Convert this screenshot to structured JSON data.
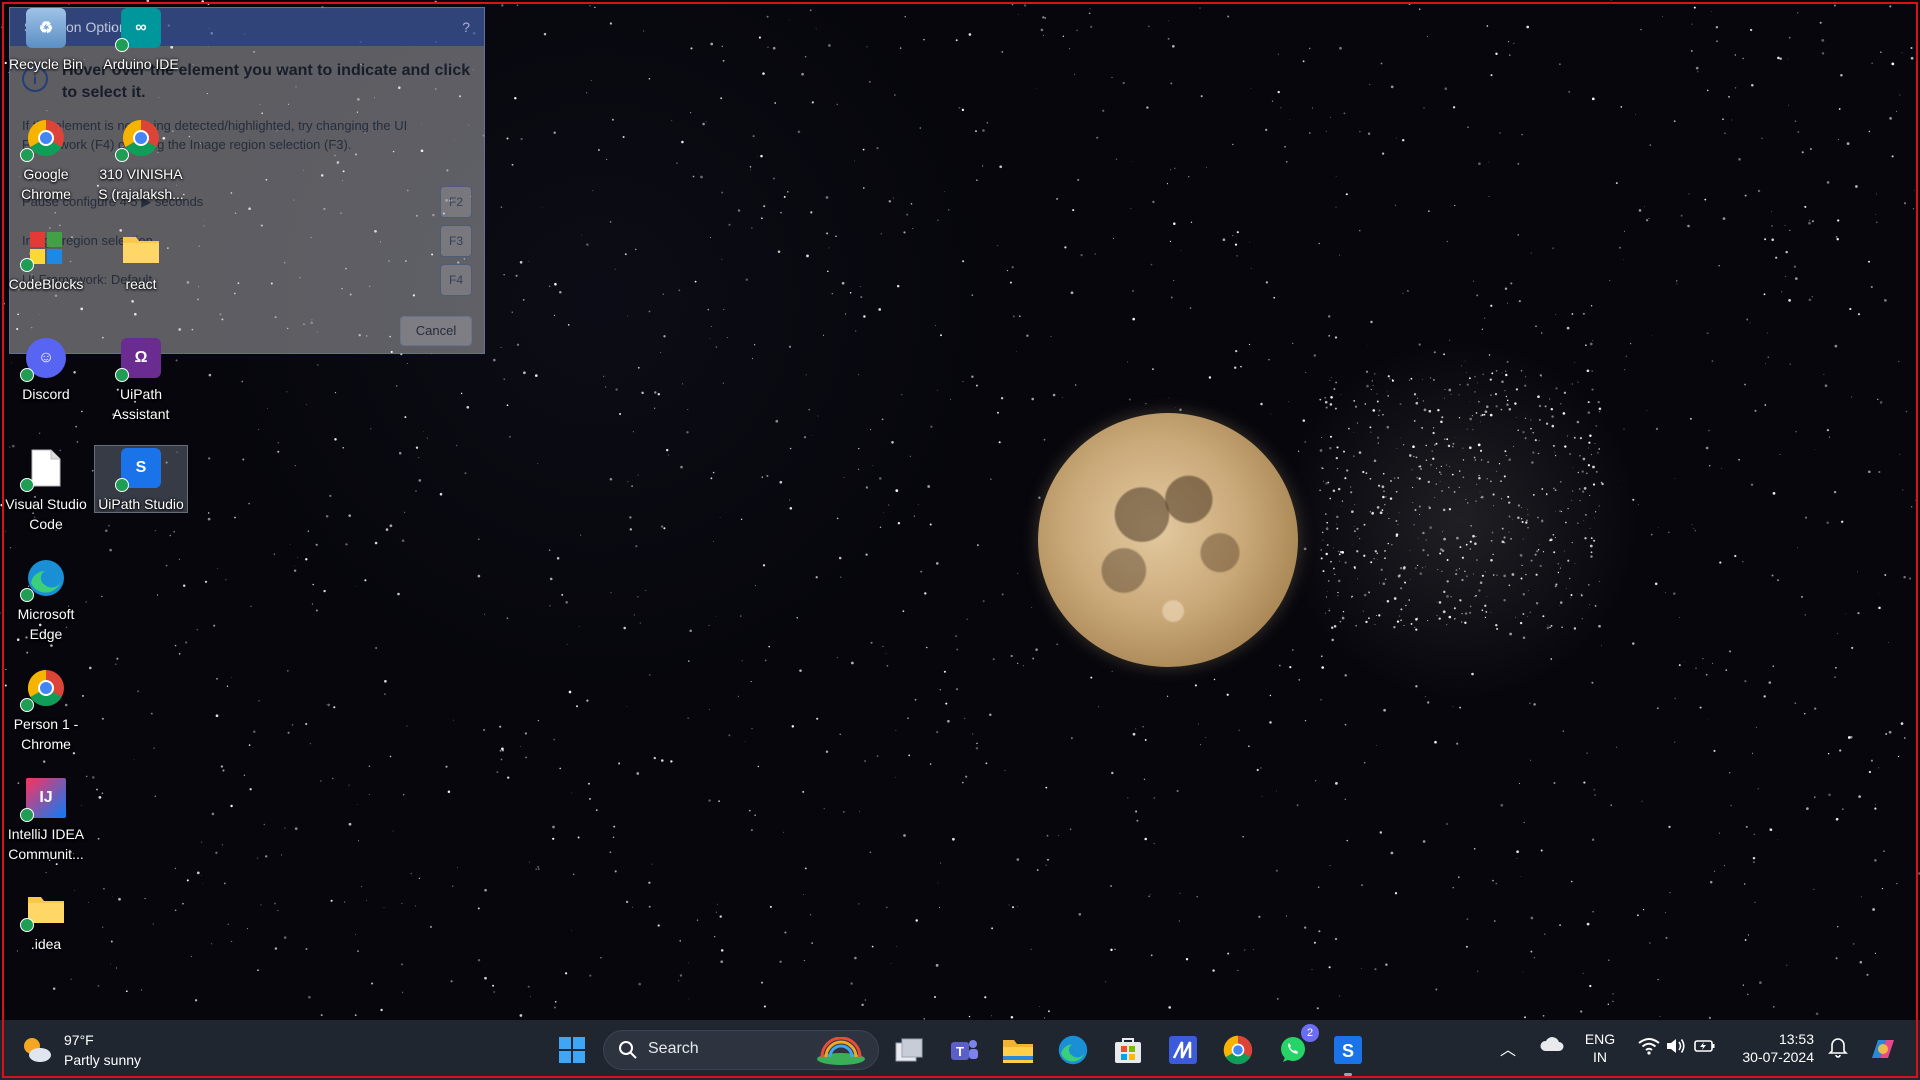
{
  "dialog": {
    "title": "Selection Options",
    "help": "?",
    "heading": "Hover over the element you want to indicate and click to select it.",
    "hint": "If the element is not being detected/highlighted, try changing the UI Framework (F4) or using the Image region selection (F3).",
    "delay_label": "Pause configure 4 5",
    "delay_unit": "seconds",
    "region_label": "Image region selection",
    "framework_label": "UI Framework:",
    "framework_value": "Default",
    "keys": [
      "F2",
      "F3",
      "F4"
    ],
    "cancel": "Cancel"
  },
  "desktop_icons": [
    {
      "label": "Recycle Bin",
      "icon": "recycle-bin-icon"
    },
    {
      "label": "Arduino IDE",
      "icon": "arduino-icon"
    },
    {
      "label": "Google Chrome",
      "icon": "chrome-icon"
    },
    {
      "label": "310 VINISHA S (rajalaksh...",
      "icon": "chrome-profile-icon"
    },
    {
      "label": "CodeBlocks",
      "icon": "codeblocks-icon"
    },
    {
      "label": "react",
      "icon": "folder-icon"
    },
    {
      "label": "Discord",
      "icon": "discord-icon"
    },
    {
      "label": "UiPath Assistant",
      "icon": "uipath-assistant-icon"
    },
    {
      "label": "Visual Studio Code",
      "icon": "file-icon"
    },
    {
      "label": "UiPath Studio",
      "icon": "uipath-studio-icon"
    },
    {
      "label": "Microsoft Edge",
      "icon": "edge-icon"
    },
    {
      "label": "Person 1 - Chrome",
      "icon": "chrome-person-icon"
    },
    {
      "label": "IntelliJ IDEA Communit...",
      "icon": "intellij-icon"
    },
    {
      "label": ".idea",
      "icon": "folder-icon"
    }
  ],
  "taskbar": {
    "weather": {
      "temp": "97°F",
      "desc": "Partly sunny"
    },
    "search_label": "Search",
    "pinned": [
      {
        "name": "task-view",
        "icon": "task-view-icon"
      },
      {
        "name": "teams",
        "icon": "teams-icon"
      },
      {
        "name": "file-explorer",
        "icon": "file-explorer-icon"
      },
      {
        "name": "edge",
        "icon": "edge-icon"
      },
      {
        "name": "microsoft-store",
        "icon": "store-icon"
      },
      {
        "name": "app",
        "icon": "app-icon"
      },
      {
        "name": "chrome",
        "icon": "chrome-icon"
      },
      {
        "name": "whatsapp",
        "icon": "whatsapp-icon",
        "badge": "2"
      },
      {
        "name": "uipath-studio",
        "icon": "uipath-studio-icon"
      }
    ],
    "tray": {
      "lang_line1": "ENG",
      "lang_line2": "IN",
      "time": "13:53",
      "date": "30-07-2024"
    }
  },
  "colors": {
    "accent": "#d8121a",
    "taskbar": "#1f2630",
    "uipath_blue": "#1a73e8"
  }
}
